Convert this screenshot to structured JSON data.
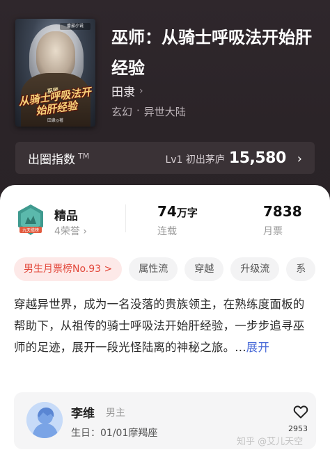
{
  "book": {
    "title": "巫师：从骑士呼吸法开始肝经验",
    "author": "田隶",
    "genre": "玄幻",
    "sub_genre": "异世大陆",
    "genre_separator": "·"
  },
  "cover": {
    "title": "从骑士呼吸法开始肝经验",
    "small_text": "巫师",
    "author_line": "田隶◎著",
    "badge": "番茄小说"
  },
  "rank": {
    "title": "出圈指数",
    "tm": "TM",
    "level": "Lv1 初出茅庐",
    "value": "15,580",
    "chevron": "›"
  },
  "stats": {
    "honor_title": "精品",
    "honor_sub": "4荣誉",
    "honor_badge_text": "九天揽榜",
    "word_count": "74",
    "word_unit": "万字",
    "status": "连载",
    "monthly_votes": "7838",
    "monthly_label": "月票"
  },
  "tags": [
    {
      "label": "男生月票榜No.93 >",
      "hot": true
    },
    {
      "label": "属性流",
      "hot": false
    },
    {
      "label": "穿越",
      "hot": false
    },
    {
      "label": "升级流",
      "hot": false
    },
    {
      "label": "系",
      "hot": false
    }
  ],
  "description": {
    "text": "穿越异世界，成为一名没落的贵族领主，在熟练度面板的帮助下，从祖传的骑士呼吸法开始肝经验，一步步追寻巫师的足迹，展开一段光怪陆离的神秘之旅。...",
    "expand_label": "展开"
  },
  "character": {
    "name": "李维",
    "role": "男主",
    "birthday": "生日：01/01摩羯座",
    "likes": "2953"
  },
  "watermark": "知乎 @艾儿天空",
  "colors": {
    "header_bg": "#2b2428",
    "accent_red": "#e2473a",
    "link_blue": "#4a6bd8"
  }
}
